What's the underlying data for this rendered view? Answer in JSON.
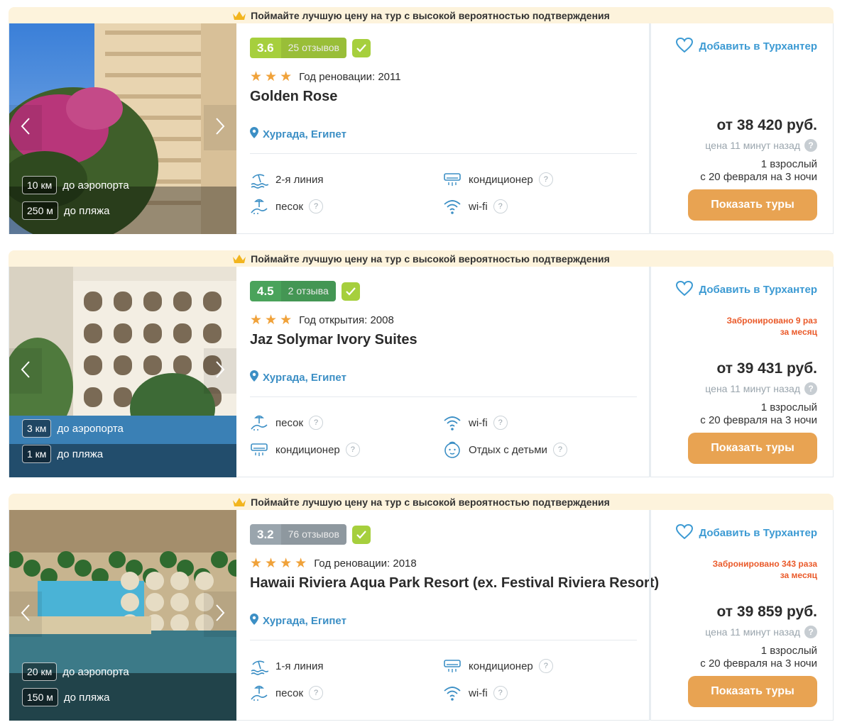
{
  "banner_text": "Поймайте лучшую цену на тур с высокой вероятностью подтверждения",
  "add_label": "Добавить в Турхантер",
  "show_button": "Показать туры",
  "updated_text": "цена 11 минут назад",
  "guests_line1": "1 взрослый",
  "guests_line2": "с 20 февраля на 3 ночи",
  "colors": {
    "accent_orange": "#e8a352",
    "link_blue": "#3c9ad3",
    "booked_red": "#ea5a2a",
    "star": "#f0a23a"
  },
  "hotels": [
    {
      "score": "3.6",
      "reviews": "25 отзывов",
      "rating_color": "#a6cf3d",
      "stars_count": 3,
      "year_label": "Год реновации: 2011",
      "name": "Golden Rose",
      "location": "Хургада, Египет",
      "airport_km": "10 км",
      "airport_label": "до аэропорта",
      "beach_km": "250 м",
      "beach_label": "до пляжа",
      "features": [
        {
          "icon": "beach-line-icon",
          "label": "2-я линия",
          "help": false
        },
        {
          "icon": "air-conditioner-icon",
          "label": "кондиционер",
          "help": true
        },
        {
          "icon": "sand-icon",
          "label": "песок",
          "help": true
        },
        {
          "icon": "wifi-icon",
          "label": "wi-fi",
          "help": true
        }
      ],
      "booked": "",
      "booked2": "",
      "price": "от 38 420 руб."
    },
    {
      "score": "4.5",
      "reviews": "2 отзыва",
      "rating_color": "#4aa35b",
      "stars_count": 3,
      "year_label": "Год открытия: 2008",
      "name": "Jaz Solymar Ivory Suites",
      "location": "Хургада, Египет",
      "airport_km": "3 км",
      "airport_label": "до аэропорта",
      "beach_km": "1 км",
      "beach_label": "до пляжа",
      "features": [
        {
          "icon": "sand-icon",
          "label": "песок",
          "help": true
        },
        {
          "icon": "wifi-icon",
          "label": "wi-fi",
          "help": true
        },
        {
          "icon": "air-conditioner-icon",
          "label": "кондиционер",
          "help": true
        },
        {
          "icon": "kids-icon",
          "label": "Отдых с детьми",
          "help": true
        }
      ],
      "booked": "Забронировано 9 раз",
      "booked2": "за месяц",
      "price": "от 39 431 руб."
    },
    {
      "score": "3.2",
      "reviews": "76 отзывов",
      "rating_color": "#9aa5ad",
      "stars_count": 4,
      "year_label": "Год реновации: 2018",
      "name": "Hawaii Riviera Aqua Park Resort (ex. Festival Riviera Resort)",
      "location": "Хургада, Египет",
      "airport_km": "20 км",
      "airport_label": "до аэропорта",
      "beach_km": "150 м",
      "beach_label": "до пляжа",
      "features": [
        {
          "icon": "beach-line-icon",
          "label": "1-я линия",
          "help": false
        },
        {
          "icon": "air-conditioner-icon",
          "label": "кондиционер",
          "help": true
        },
        {
          "icon": "sand-icon",
          "label": "песок",
          "help": true
        },
        {
          "icon": "wifi-icon",
          "label": "wi-fi",
          "help": true
        }
      ],
      "booked": "Забронировано 343 раза",
      "booked2": "за месяц",
      "price": "от 39 859 руб."
    }
  ]
}
